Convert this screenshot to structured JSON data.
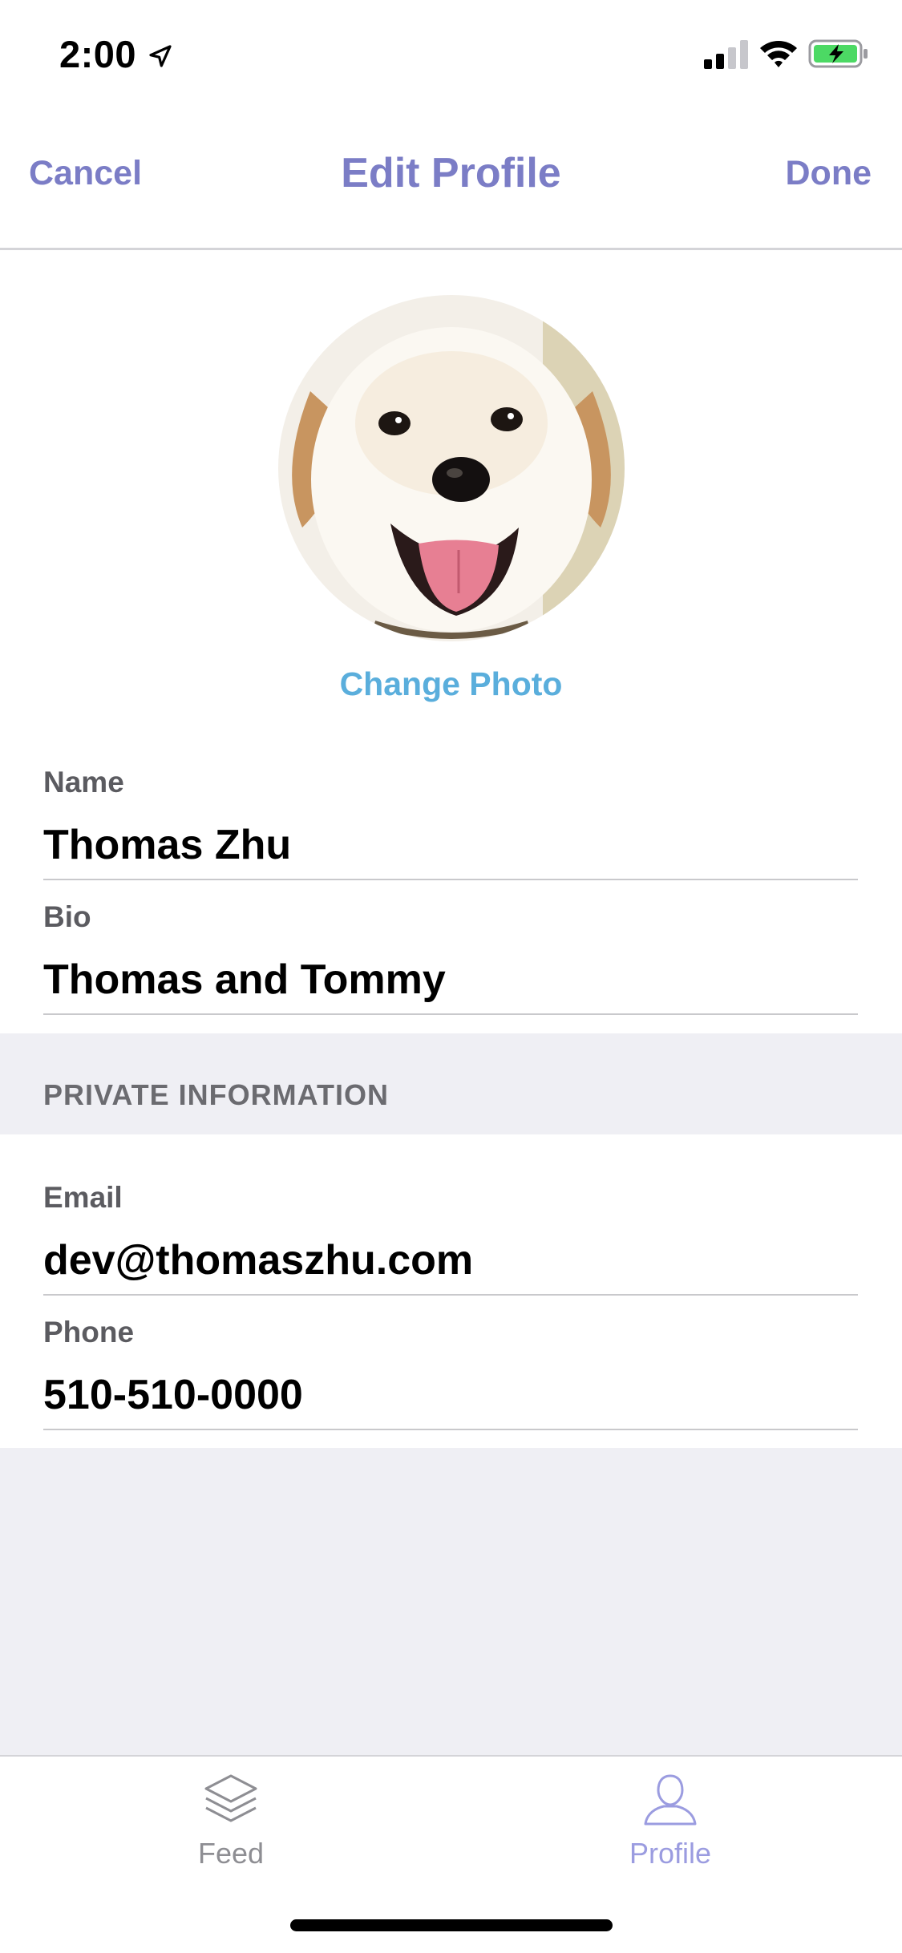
{
  "status_bar": {
    "time": "2:00",
    "icons": [
      "location-arrow-icon",
      "cellular-signal-icon",
      "wifi-icon",
      "battery-charging-icon"
    ],
    "battery_color": "#4cd964"
  },
  "nav": {
    "cancel_label": "Cancel",
    "title": "Edit Profile",
    "done_label": "Done",
    "accent_color": "#7b7dc6"
  },
  "photo": {
    "change_photo_label": "Change Photo",
    "link_color": "#5aaedc"
  },
  "fields": {
    "name": {
      "label": "Name",
      "value": "Thomas Zhu"
    },
    "bio": {
      "label": "Bio",
      "value": "Thomas and Tommy"
    }
  },
  "private_section": {
    "header": "PRIVATE INFORMATION",
    "email": {
      "label": "Email",
      "value": "dev@thomaszhu.com"
    },
    "phone": {
      "label": "Phone",
      "value": "510-510-0000"
    }
  },
  "tabs": [
    {
      "label": "Feed",
      "icon": "layers-icon",
      "active": false
    },
    {
      "label": "Profile",
      "icon": "person-icon",
      "active": true
    }
  ]
}
